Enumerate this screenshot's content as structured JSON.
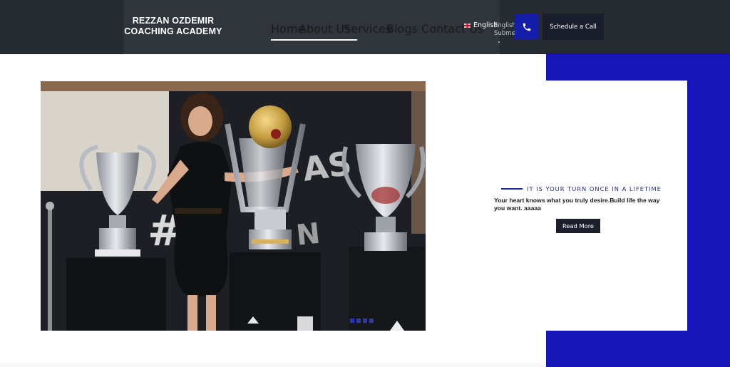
{
  "header": {
    "logo_line1": "REZZAN OZDEMIR",
    "logo_line2": "COACHING ACADEMY",
    "nav": [
      {
        "label": "Home",
        "active": true,
        "dropdown": false
      },
      {
        "label": "About Us",
        "active": true,
        "dropdown": true
      },
      {
        "label": "Services",
        "active": false,
        "dropdown": true
      },
      {
        "label": "Blogs",
        "active": false,
        "dropdown": true
      },
      {
        "label": "Contact Us",
        "active": false,
        "dropdown": false
      }
    ],
    "language": "English",
    "submenu_ghost": "English Submenu",
    "schedule_label": "Schedule a Call",
    "icons": {
      "phone": "phone-icon",
      "chevron": "chevron-down-icon",
      "flag": "uk-flag-icon"
    }
  },
  "hero": {
    "tagline": "IT IS YOUR TURN ONCE IN A LIFETIME",
    "subtext": "Your heart knows what you truly desire.Build life the way you want. aaaaa",
    "cta_label": "Read More",
    "slides_total": 4,
    "slide_active": 1
  },
  "colors": {
    "header_bg": "#252b31",
    "accent_blue": "#1616b8",
    "button_dark": "#1b1f2b",
    "tagline_blue": "#1f2a8e"
  }
}
